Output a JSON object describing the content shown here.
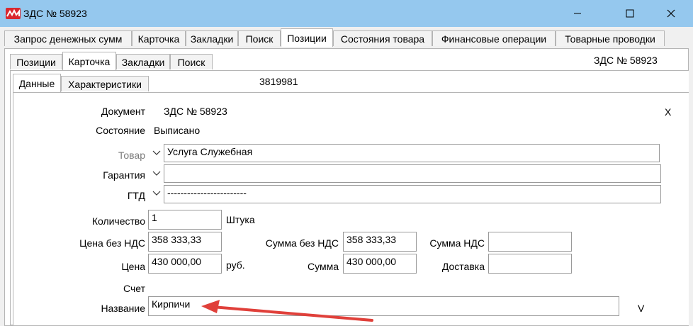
{
  "window": {
    "title": "ЗДС № 58923",
    "minimize": "—",
    "maximize": "☐",
    "close": "✕"
  },
  "outer_tabs": [
    "Запрос денежных сумм",
    "Карточка",
    "Закладки",
    "Поиск",
    "Позиции",
    "Состояния товара",
    "Финансовые операции",
    "Товарные проводки"
  ],
  "inner_tabs": [
    "Позиции",
    "Карточка",
    "Закладки",
    "Поиск"
  ],
  "sub_tabs": [
    "Данные",
    "Характеристики"
  ],
  "header_doc": "ЗДС № 58923",
  "id_value": "3819981",
  "form": {
    "doc_label": "Документ",
    "doc_value": "ЗДС № 58923",
    "close_x": "X",
    "state_label": "Состояние",
    "state_value": "Выписано",
    "goods_label": "Товар",
    "goods_value": "Услуга Служебная",
    "guarantee_label": "Гарантия",
    "guarantee_value": "",
    "gtd_label": "ГТД",
    "gtd_value": "------------------------",
    "qty_label": "Количество",
    "qty_value": "1",
    "qty_unit": "Штука",
    "price_novat_label": "Цена без НДС",
    "price_novat_value": "358 333,33",
    "sum_novat_label": "Сумма без НДС",
    "sum_novat_value": "358 333,33",
    "vat_label": "Сумма НДС",
    "vat_value": "",
    "price_label": "Цена",
    "price_value": "430 000,00",
    "price_unit": "руб.",
    "sum_label": "Сумма",
    "sum_value": "430 000,00",
    "delivery_label": "Доставка",
    "delivery_value": "",
    "invoice_label": "Счет",
    "name_label": "Название",
    "name_value": "Кирпичи",
    "name_suffix": "V"
  },
  "colors": {
    "titlebar": "#95c8ee",
    "arrow": "#e0403a",
    "app_icon": "#d9272e"
  }
}
